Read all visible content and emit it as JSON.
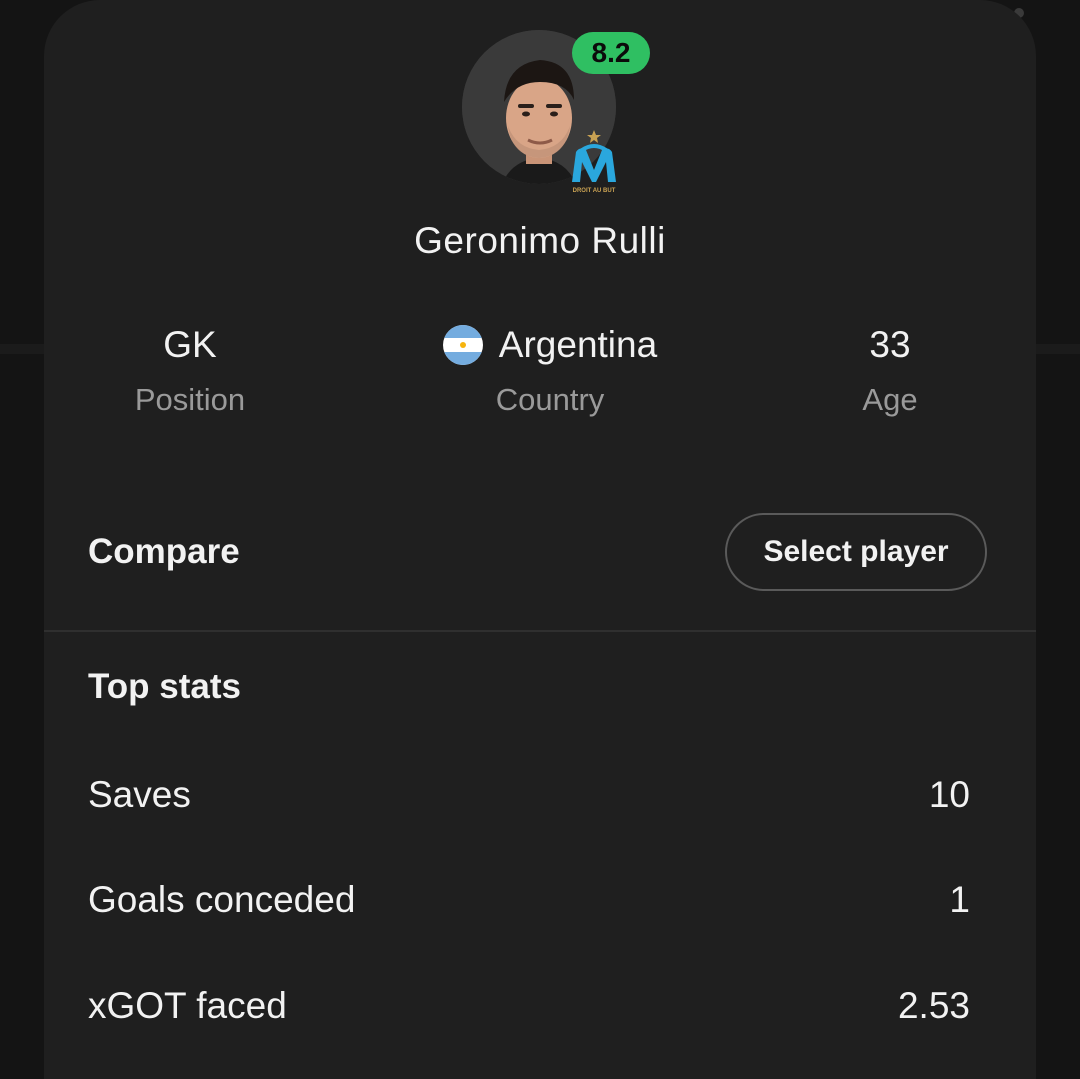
{
  "player": {
    "name": "Geronimo Rulli",
    "rating": "8.2",
    "club_badge_icon": "olympique-marseille-crest-icon",
    "club_motto": "DROIT AU BUT"
  },
  "info": [
    {
      "key": "position",
      "value": "GK",
      "label": "Position"
    },
    {
      "key": "country",
      "value": "Argentina",
      "label": "Country",
      "flag_icon": "argentina-flag-icon"
    },
    {
      "key": "age",
      "value": "33",
      "label": "Age"
    }
  ],
  "compare": {
    "label": "Compare",
    "button_label": "Select player"
  },
  "top_stats": {
    "title": "Top stats",
    "rows": [
      {
        "label": "Saves",
        "value": "10"
      },
      {
        "label": "Goals conceded",
        "value": "1"
      },
      {
        "label": "xGOT faced",
        "value": "2.53"
      }
    ]
  },
  "colors": {
    "background": "#141414",
    "sheet": "#1f1f1f",
    "rating_badge": "#2fbf62",
    "secondary_text": "#9a9a9a",
    "club_blue": "#2aa7dd"
  }
}
